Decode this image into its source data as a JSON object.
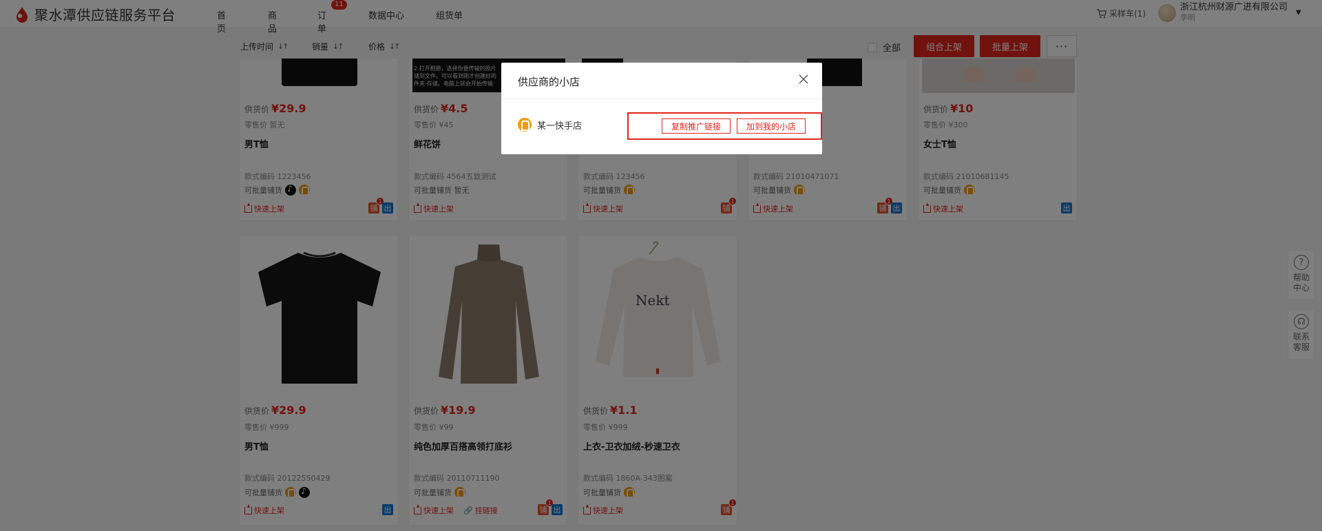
{
  "header": {
    "title": "聚水潭供应链服务平台",
    "nav": [
      {
        "label": "首页"
      },
      {
        "label": "商品"
      },
      {
        "label": "订单",
        "badge": "11"
      },
      {
        "label": "数据中心"
      },
      {
        "label": "组货单"
      }
    ],
    "cart": "采样车(1)",
    "company": "浙江杭州财源广进有限公司",
    "user": "李明"
  },
  "toolbar": {
    "sort": [
      {
        "label": "上传时间",
        "arrows": "↓↑"
      },
      {
        "label": "销量",
        "arrows": "↓↑"
      },
      {
        "label": "价格",
        "arrows": "↓↑"
      }
    ],
    "select_all": "全部",
    "combo_btn": "组合上架",
    "batch_btn": "批量上架",
    "more_btn": "···"
  },
  "labels": {
    "supply": "供货价",
    "retail": "零售价",
    "code": "款式编码",
    "stock": "可批量铺货",
    "quick": "快速上架",
    "chain": "挂链接",
    "tag_pu": "铺",
    "tag_chu": "出"
  },
  "cards_row1": [
    {
      "price": "¥29.9",
      "retail": "暂无",
      "name": "男T恤",
      "code": "1223456",
      "stock_text": ""
    },
    {
      "price": "¥4.5",
      "retail": "¥45",
      "name": "鲜花饼",
      "code": "4564五致测试",
      "stock_text": "暂无"
    },
    {
      "price": "",
      "retail": "",
      "name": "",
      "code": "123456",
      "stock_text": ""
    },
    {
      "price": "",
      "retail": "",
      "name": "",
      "code": "21010471071",
      "stock_text": ""
    },
    {
      "price": "¥10",
      "retail": "¥300",
      "name": "女士T恤",
      "code": "21010681145",
      "stock_text": ""
    }
  ],
  "cards_row2": [
    {
      "price": "¥29.9",
      "retail": "¥999",
      "name": "男T恤",
      "code": "20122550429"
    },
    {
      "price": "¥19.9",
      "retail": "¥99",
      "name": "纯色加厚百搭高领打底衫",
      "code": "20110711190"
    },
    {
      "price": "¥1.1",
      "retail": "¥999",
      "name": "上衣-卫衣加绒-秒速卫衣",
      "code": "1860A-343图案"
    }
  ],
  "card_counts": {
    "one": "1"
  },
  "product2_caption": "2.打开相册，选择你要传输的照片\n储到文件。可以看到刚才创建好的\n件夹-存储。电脑上就会开始传输",
  "float": {
    "help": "帮助中心",
    "service": "联系客服"
  },
  "modal": {
    "title": "供应商的小店",
    "shop": "某一快手店",
    "copy_btn": "复制推广链接",
    "add_btn": "加到我的小店"
  },
  "colors": {
    "accent": "#e1251b",
    "kuaishou": "#f39a0e",
    "blue_tag": "#1677d2"
  }
}
